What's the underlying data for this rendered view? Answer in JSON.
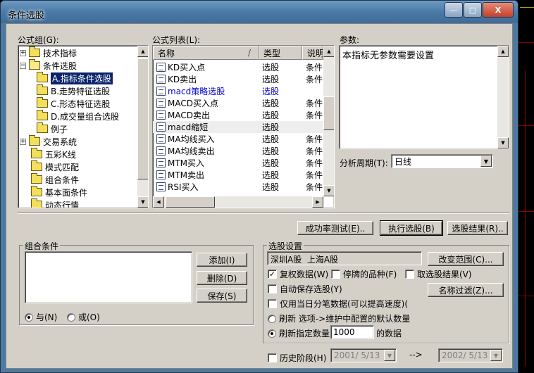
{
  "window": {
    "title": "条件选股"
  },
  "formula_group": {
    "label": "公式组(G):",
    "tree": [
      {
        "label": "技术指标",
        "expander": "+"
      },
      {
        "label": "条件选股",
        "expander": "-"
      },
      {
        "label": "A.指标条件选股"
      },
      {
        "label": "B.走势特征选股"
      },
      {
        "label": "C.形态特征选股"
      },
      {
        "label": "D.成交量组合选股"
      },
      {
        "label": "例子"
      },
      {
        "label": "交易系统",
        "expander": "+"
      },
      {
        "label": "五彩K线"
      },
      {
        "label": "模式匹配"
      },
      {
        "label": "组合条件"
      },
      {
        "label": "基本面条件"
      },
      {
        "label": "动态行情"
      }
    ]
  },
  "formula_list": {
    "label": "公式列表(L):",
    "columns": [
      "名称",
      "类型",
      "说明"
    ],
    "sort_marker": "/",
    "rows": [
      {
        "name": "KD买入点",
        "type": "选股",
        "desc": "条件"
      },
      {
        "name": "KD卖出",
        "type": "选股",
        "desc": "条件"
      },
      {
        "name": "macd策略选股",
        "type": "选股",
        "desc": ""
      },
      {
        "name": "MACD买入点",
        "type": "选股",
        "desc": "条件"
      },
      {
        "name": "MACD卖出",
        "type": "选股",
        "desc": "条件"
      },
      {
        "name": "macd缩短",
        "type": "选股",
        "desc": ""
      },
      {
        "name": "MA均线买入",
        "type": "选股",
        "desc": "条件"
      },
      {
        "name": "MA均线卖出",
        "type": "选股",
        "desc": "条件"
      },
      {
        "name": "MTM买入",
        "type": "选股",
        "desc": "条件"
      },
      {
        "name": "MTM卖出",
        "type": "选股",
        "desc": "条件"
      },
      {
        "name": "RSI买入",
        "type": "选股",
        "desc": "条件"
      }
    ]
  },
  "params": {
    "label": "参数:",
    "text": "本指标无参数需要设置",
    "period_label": "分析周期(T):",
    "period_value": "日线"
  },
  "actions": {
    "success_test": "成功率测试(E)..",
    "execute": "执行选股(B)",
    "result": "选股结果(R).."
  },
  "combo_conditions": {
    "title": "组合条件",
    "add": "添加(I)",
    "delete": "删除(D)",
    "save": "保存(S)",
    "and_label": "与(N)",
    "or_label": "或(O)"
  },
  "settings": {
    "title": "选股设置",
    "markets": "深圳A股  上海A股",
    "change_range": "改变范围(C)...",
    "name_filter": "名称过滤(Z)...",
    "options": {
      "adjusted": "复权数据(W)",
      "suspended": "停牌的品种(F)",
      "inverse": "取选股结果(V)",
      "autosave": "自动保存选股(Y)",
      "tick_only": "仅用当日分笔数据(可以提高速度)(",
      "refresh_default": "刷新 选项->维护中配置的默认数量",
      "refresh_count": "刷新指定数量",
      "count_value": "1000",
      "count_suffix": "的数据"
    },
    "history": {
      "label": "历史阶段(H)",
      "from": "2001/ 5/13",
      "arrow": "-->",
      "to": "2002/ 5/13"
    }
  },
  "icons": {
    "expand": "plus-icon",
    "collapse": "minus-icon",
    "folder": "folder-icon",
    "formula": "document-icon",
    "scroll_up": "▲",
    "scroll_down": "▼",
    "scroll_left": "◀",
    "scroll_right": "▶",
    "dropdown": "▼",
    "minimize": "—",
    "maximize": "□",
    "close": "X"
  },
  "colors": {
    "selection": "#0a246a",
    "link_blue": "#0000d0",
    "dialog_face": "#d4d0c8"
  }
}
